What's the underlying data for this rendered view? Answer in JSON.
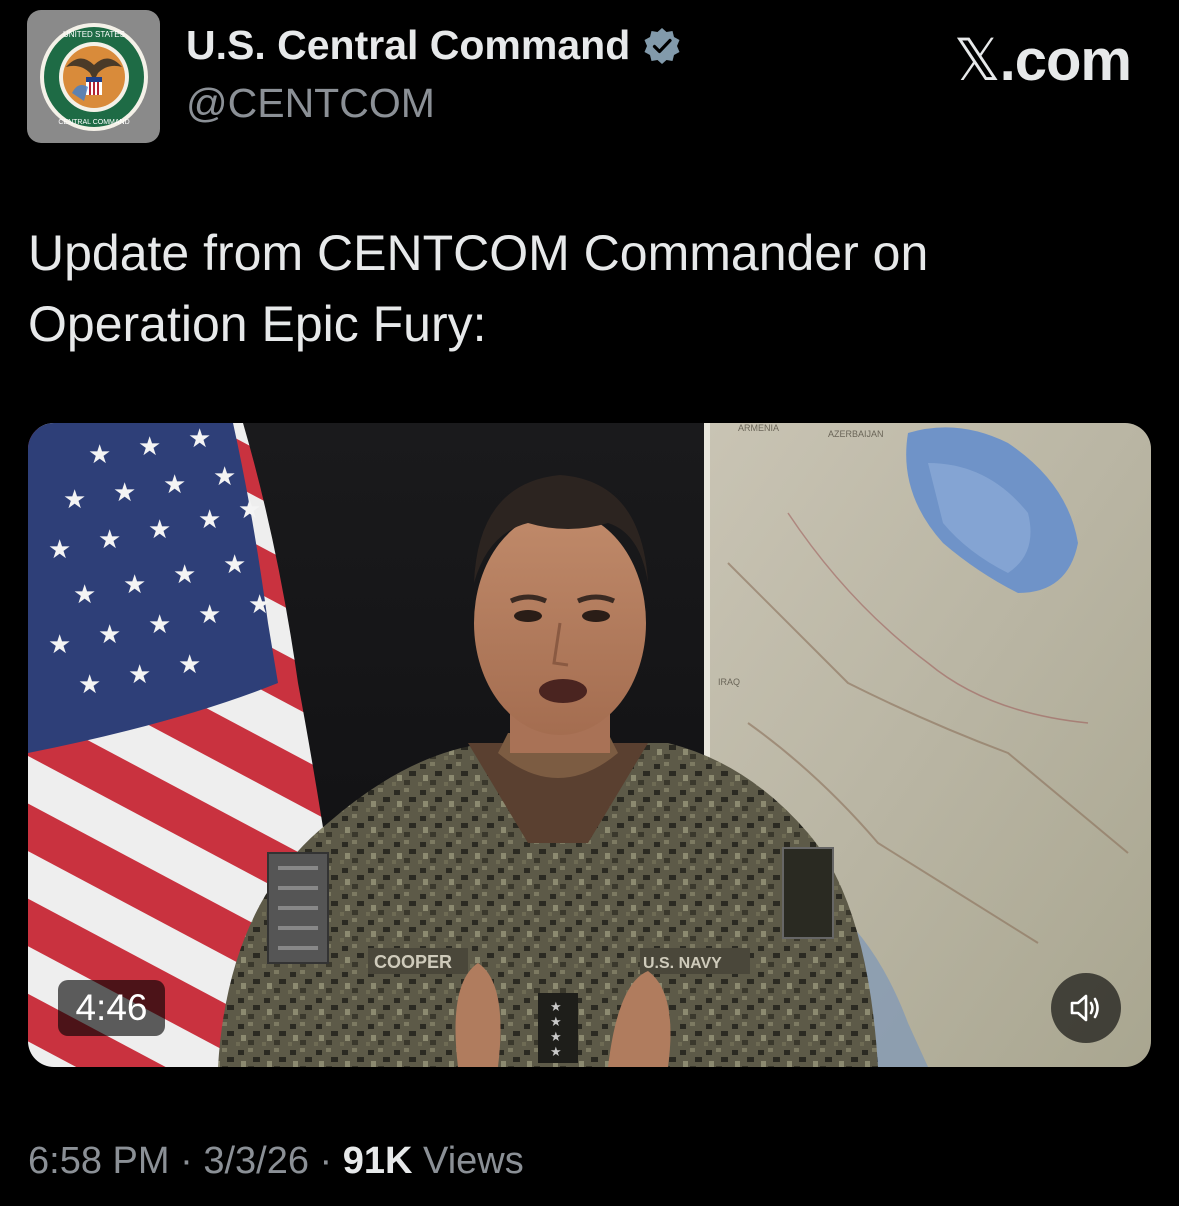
{
  "author": {
    "display_name": "U.S. Central Command",
    "handle": "@CENTCOM",
    "verified": true,
    "avatar_icon": "centcom-seal-icon",
    "avatar_seal_text_top": "UNITED STATES",
    "avatar_seal_text_bottom": "CENTRAL COMMAND"
  },
  "brand": {
    "glyph": "𝕏",
    "suffix": ".com"
  },
  "tweet": {
    "text": "Update from CENTCOM Commander on Operation Epic Fury:"
  },
  "media": {
    "duration": "4:46",
    "volume_icon": "speaker-icon",
    "scene_labels": {
      "name_tape": "COOPER",
      "branch_tape": "U.S. NAVY",
      "map_label_1": "ARMENIA",
      "map_label_2": "AZERBAIJAN",
      "map_label_3": "IRAQ"
    }
  },
  "footer": {
    "time": "6:58 PM",
    "separator": "·",
    "date": "3/3/26",
    "views_count": "91K",
    "views_label": "Views"
  },
  "colors": {
    "background": "#000000",
    "text_primary": "#e7e9ea",
    "text_secondary": "#8b9096",
    "verified_badge": "#829aab"
  }
}
